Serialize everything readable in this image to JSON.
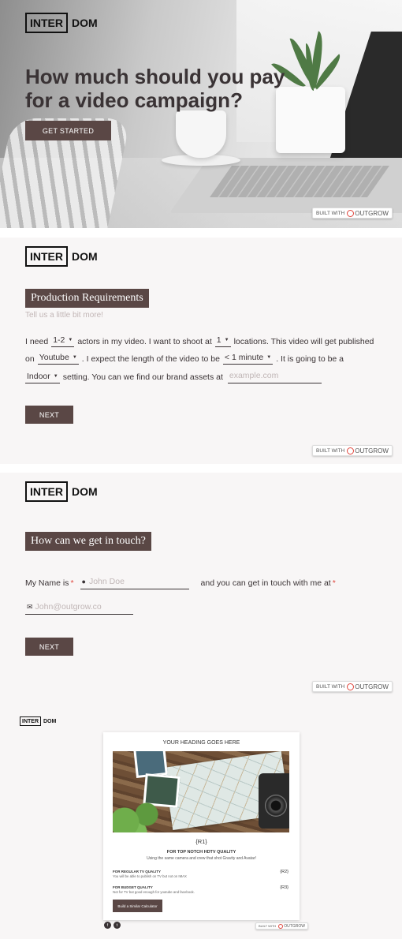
{
  "brand": {
    "logo_box": "INTER",
    "logo_rest": "DOM"
  },
  "colors": {
    "accent": "#5a4745",
    "required": "#e0463d",
    "text": "#3a3335"
  },
  "hero": {
    "headline": "How much should you pay for a video campaign?",
    "cta_label": "GET STARTED"
  },
  "built_with": {
    "prefix": "BUILT WITH",
    "brand": "OUTGROW"
  },
  "production": {
    "heading": "Production Requirements",
    "subheading": "Tell us a little bit more!",
    "s1_a": "I need",
    "actors_value": "1-2",
    "s1_b": "actors in my video.  I want to shoot at",
    "locations_value": "1",
    "s1_c": "locations.  This video will get published",
    "s2_a": "on",
    "platform_value": "Youtube",
    "s2_b": ".  I expect the length of the video to be",
    "length_value": "< 1 minute",
    "s2_c": ".  It is going to be a",
    "setting_value": "Indoor",
    "s3_a": "setting.  You can we find our brand assets at",
    "assets_placeholder": "example.com",
    "next_label": "NEXT"
  },
  "contact": {
    "heading": "How can we get in touch?",
    "name_label": "My Name is",
    "name_placeholder": "John Doe",
    "middle_text": "and you can get in touch with me at",
    "email_placeholder": "John@outgrow.co",
    "required_mark": "*",
    "next_label": "NEXT"
  },
  "result": {
    "heading": "YOUR HEADING GOES HERE",
    "main_value": "{R1}",
    "tier_title": "FOR TOP NOTCH HDTV QUALITY",
    "tier_desc": "Using the same camera and crew that shot Gravity and Avatar!",
    "rows": [
      {
        "title": "FOR REGULAR TV QUALITY",
        "desc": "You will be able to publish on TV but not on IMAX",
        "value": "{R2}"
      },
      {
        "title": "FOR BUDGET QUALITY",
        "desc": "Not for TV but good enough for youtube and facebook.",
        "value": "{R3}"
      }
    ],
    "button_label": "Build a Similar Calculator"
  },
  "icons": {
    "caret": "caret-down-icon",
    "user": "user-icon",
    "mail": "mail-icon"
  }
}
